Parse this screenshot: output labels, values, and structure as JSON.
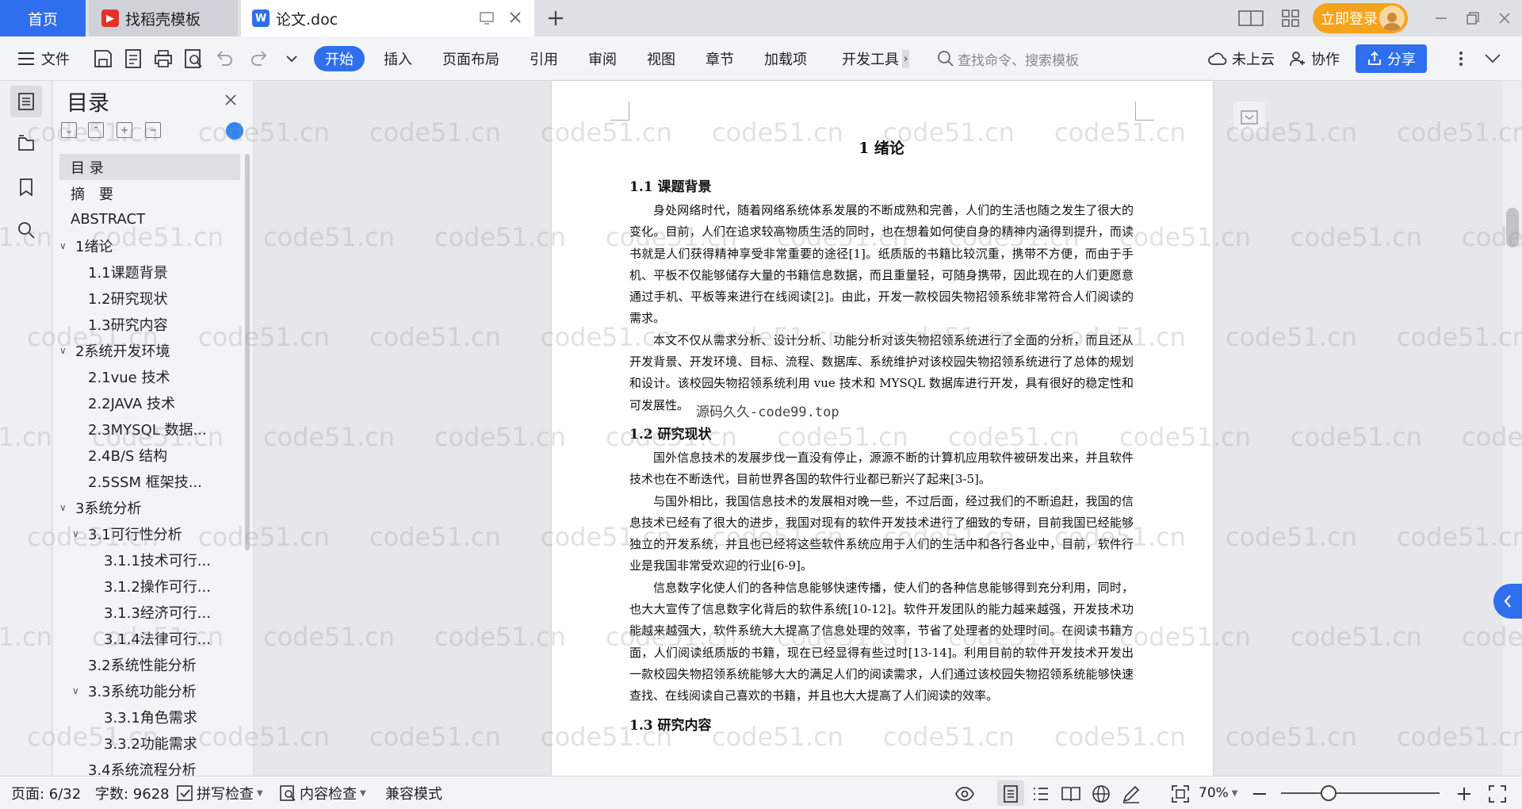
{
  "tabs": {
    "home": "首页",
    "daoke": "找稻壳模板",
    "doc": "论文.doc"
  },
  "login": "立即登录",
  "toolbar": {
    "file": "文件",
    "ribbon_tabs": [
      "开始",
      "插入",
      "页面布局",
      "引用",
      "审阅",
      "视图",
      "章节",
      "加载项",
      "开发工具"
    ],
    "search_placeholder": "查找命令、搜索模板",
    "cloud": "未上云",
    "collab": "协作",
    "share": "分享"
  },
  "toc": {
    "title": "目录",
    "items": [
      {
        "label": "目 录",
        "level": 1,
        "selected": true
      },
      {
        "label": "摘　要",
        "level": 1
      },
      {
        "label": "ABSTRACT",
        "level": 1
      },
      {
        "label": "1绪论",
        "level": 1,
        "expanded": true
      },
      {
        "label": "1.1课题背景",
        "level": 2
      },
      {
        "label": "1.2研究现状",
        "level": 2
      },
      {
        "label": "1.3研究内容",
        "level": 2
      },
      {
        "label": "2系统开发环境",
        "level": 1,
        "expanded": true
      },
      {
        "label": "2.1vue 技术",
        "level": 2
      },
      {
        "label": "2.2JAVA 技术",
        "level": 2
      },
      {
        "label": "2.3MYSQL 数据...",
        "level": 2
      },
      {
        "label": "2.4B/S 结构",
        "level": 2
      },
      {
        "label": "2.5SSM 框架技...",
        "level": 2
      },
      {
        "label": "3系统分析",
        "level": 1,
        "expanded": true
      },
      {
        "label": "3.1可行性分析",
        "level": 2,
        "expanded": true
      },
      {
        "label": "3.1.1技术可行...",
        "level": 3
      },
      {
        "label": "3.1.2操作可行...",
        "level": 3
      },
      {
        "label": "3.1.3经济可行...",
        "level": 3
      },
      {
        "label": "3.1.4法律可行...",
        "level": 3
      },
      {
        "label": "3.2系统性能分析",
        "level": 2
      },
      {
        "label": "3.3系统功能分析",
        "level": 2,
        "expanded": true
      },
      {
        "label": "3.3.1角色需求",
        "level": 3
      },
      {
        "label": "3.3.2功能需求",
        "level": 3
      },
      {
        "label": "3.4系统流程分析",
        "level": 2
      }
    ]
  },
  "document": {
    "chapter_title": "1  绪论",
    "section_1": "1.1  课题背景",
    "para_1": "身处网络时代，随着网络系统体系发展的不断成熟和完善，人们的生活也随之发生了很大的变化。目前，人们在追求较高物质生活的同时，也在想着如何使自身的精神内涵得到提升，而读书就是人们获得精神享受非常重要的途径[1]。纸质版的书籍比较沉重，携带不方便，而由于手机、平板不仅能够储存大量的书籍信息数据，而且重量轻，可随身携带，因此现在的人们更愿意通过手机、平板等来进行在线阅读[2]。由此，开发一款校园失物招领系统非常符合人们阅读的需求。",
    "para_2": "本文不仅从需求分析、设计分析、功能分析对该失物招领系统进行了全面的分析，而且还从开发背景、开发环境、目标、流程、数据库、系统维护对该校园失物招领系统进行了总体的规划和设计。该校园失物招领系统利用 vue 技术和 MYSQL 数据库进行开发，具有很好的稳定性和可发展性。",
    "section_2": "1.2  研究现状",
    "para_3": "国外信息技术的发展步伐一直没有停止，源源不断的计算机应用软件被研发出来，并且软件技术也在不断迭代，目前世界各国的软件行业都已新兴了起来[3-5]。",
    "para_4": "与国外相比，我国信息技术的发展相对晚一些，不过后面，经过我们的不断追赶，我国的信息技术已经有了很大的进步，我国对现有的软件开发技术进行了细致的专研，目前我国已经能够独立的开发系统，并且也已经将这些软件系统应用于人们的生活中和各行各业中，目前，软件行业是我国非常受欢迎的行业[6-9]。",
    "para_5": "信息数字化使人们的各种信息能够快速传播，使人们的各种信息能够得到充分利用，同时，也大大宣传了信息数字化背后的软件系统[10-12]。软件开发团队的能力越来越强，开发技术功能越来越强大，软件系统大大提高了信息处理的效率，节省了处理者的处理时间。在阅读书籍方面，人们阅读纸质版的书籍，现在已经显得有些过时[13-14]。利用目前的软件开发技术开发出一款校园失物招领系统能够大大的满足人们的阅读需求，人们通过该校园失物招领系统能够快速查找、在线阅读自己喜欢的书籍，并且也大大提高了人们阅读的效率。",
    "section_3": "1.3  研究内容"
  },
  "watermark": {
    "text": "code51.cn",
    "center": "源码久久-code99.top"
  },
  "status": {
    "page": "页面: 6/32",
    "words": "字数: 9628",
    "spell": "拼写检查",
    "content": "内容检查",
    "compat": "兼容模式",
    "zoom": "70%",
    "zoom_fraction": 0.3
  },
  "colors": {
    "accent": "#2f6fed",
    "login": "#f4a41c"
  }
}
